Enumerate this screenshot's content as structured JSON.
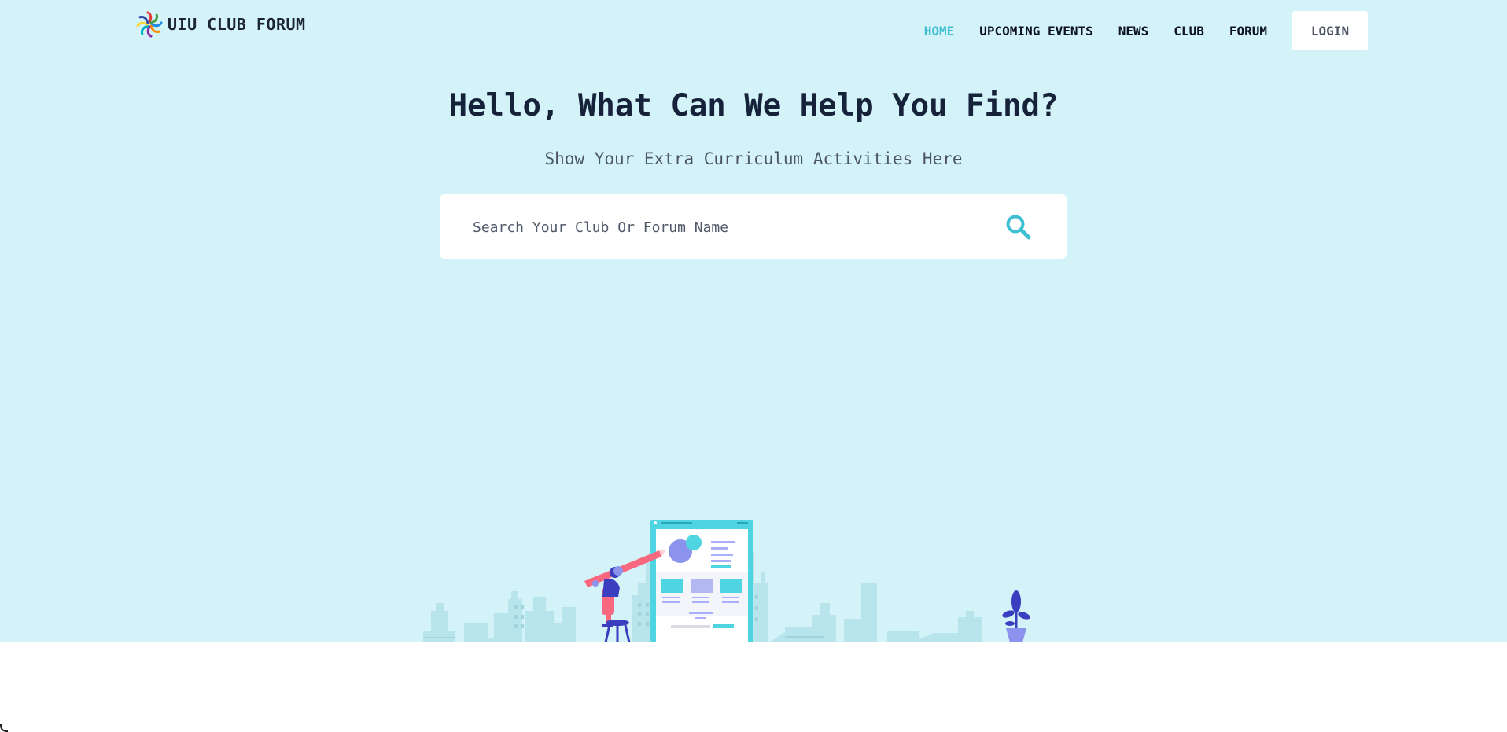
{
  "brand": {
    "name": "UIU CLUB FORUM",
    "logo_icon": "pinwheel-logo-icon"
  },
  "nav": {
    "items": [
      {
        "label": "HOME",
        "active": true
      },
      {
        "label": "UPCOMING EVENTS",
        "active": false
      },
      {
        "label": "NEWS",
        "active": false
      },
      {
        "label": "CLUB",
        "active": false
      },
      {
        "label": "FORUM",
        "active": false
      }
    ],
    "login_label": "LOGIN"
  },
  "hero": {
    "title": "Hello, What Can We Help You Find?",
    "subtitle": "Show Your Extra Curriculum Activities Here",
    "illustration": "person-designing-web-page-cityscape"
  },
  "search": {
    "placeholder": "Search Your Club Or Forum Name",
    "value": "",
    "icon": "search-icon"
  },
  "colors": {
    "hero_background": "#d3f3f9",
    "accent": "#3fbfd3",
    "heading": "#16213a",
    "white": "#ffffff"
  }
}
